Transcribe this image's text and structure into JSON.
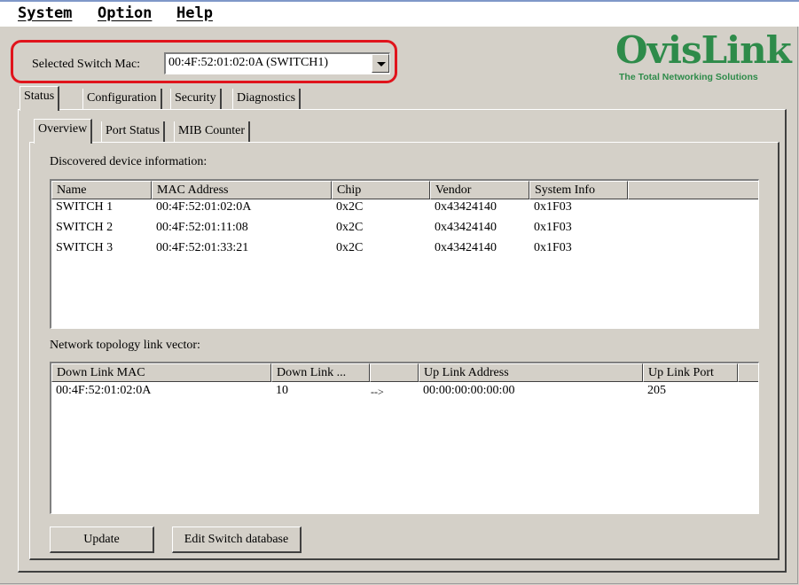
{
  "menu": {
    "system": "System",
    "option": "Option",
    "help": "Help"
  },
  "selection": {
    "label": "Selected Switch Mac:",
    "value": "00:4F:52:01:02:0A (SWITCH1)"
  },
  "logo": {
    "name": "OvisLink",
    "tagline": "The Total Networking Solutions"
  },
  "tabs": [
    "Status",
    "Configuration",
    "Security",
    "Diagnostics"
  ],
  "subtabs": [
    "Overview",
    "Port Status",
    "MIB Counter"
  ],
  "devices": {
    "label": "Discovered device information:",
    "columns": [
      "Name",
      "MAC Address",
      "Chip",
      "Vendor",
      "System Info",
      ""
    ],
    "rows": [
      [
        "SWITCH 1",
        "00:4F:52:01:02:0A",
        "0x2C",
        "0x43424140",
        "0x1F03"
      ],
      [
        "SWITCH 2",
        "00:4F:52:01:11:08",
        "0x2C",
        "0x43424140",
        "0x1F03"
      ],
      [
        "SWITCH 3",
        "00:4F:52:01:33:21",
        "0x2C",
        "0x43424140",
        "0x1F03"
      ]
    ]
  },
  "topology": {
    "label": "Network topology link vector:",
    "columns": [
      "Down Link MAC",
      "Down Link ...",
      "",
      "Up Link Address",
      "Up Link Port",
      ""
    ],
    "rows": [
      [
        "00:4F:52:01:02:0A",
        "10",
        "-->",
        "00:00:00:00:00:00",
        "205"
      ]
    ]
  },
  "buttons": {
    "update": "Update",
    "edit": "Edit Switch database"
  },
  "colors": {
    "highlight": "#e0141c",
    "logo": "#2e8b4a",
    "face": "#d4d0c8"
  }
}
